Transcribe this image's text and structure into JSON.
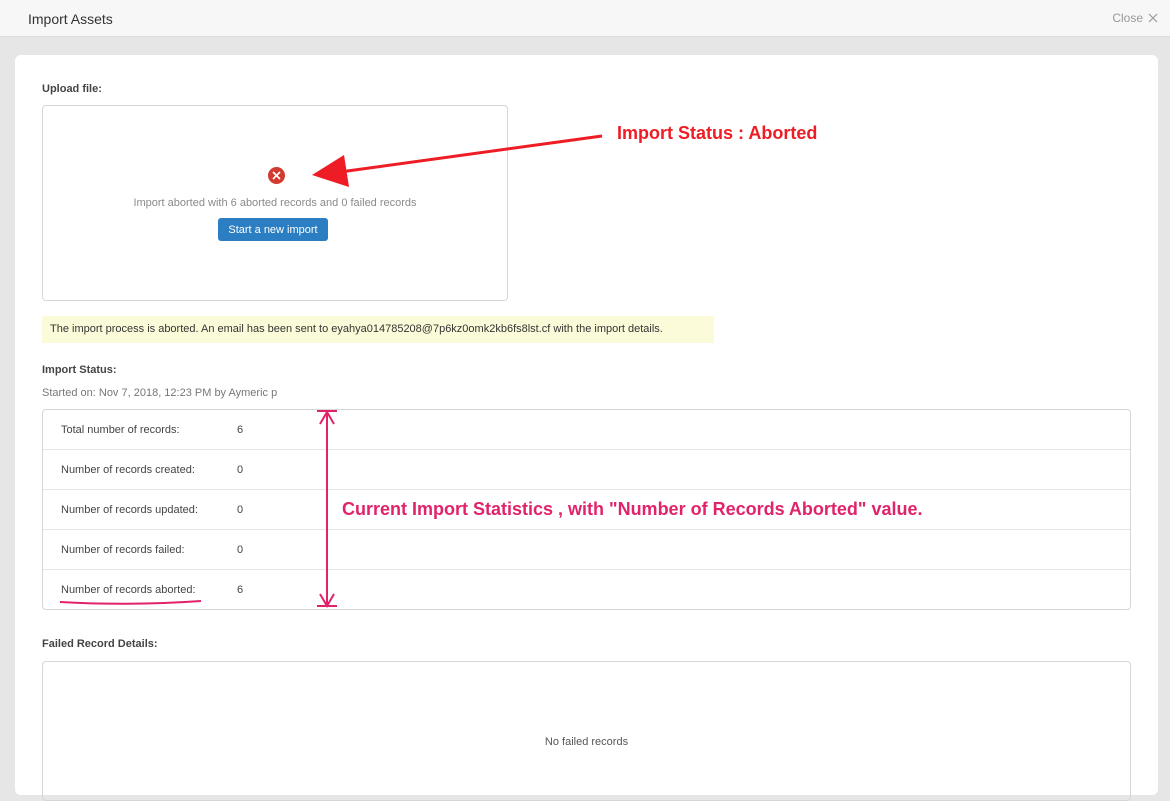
{
  "window": {
    "title": "Import Assets",
    "close_label": "Close"
  },
  "upload": {
    "section_label": "Upload file:",
    "status_icon": "error-x-icon",
    "message": "Import aborted with 6 aborted records and 0 failed records",
    "new_import_button": "Start a new import"
  },
  "notice": {
    "text": "The import process is aborted. An email has been sent to eyahya014785208@7p6kz0omk2kb6fs8lst.cf with the import details."
  },
  "import_status": {
    "section_label": "Import Status:",
    "started": "Started on: Nov 7, 2018, 12:23 PM by Aymeric p",
    "rows": [
      {
        "label": "Total number of records:",
        "value": "6"
      },
      {
        "label": "Number of records created:",
        "value": "0"
      },
      {
        "label": "Number of records updated:",
        "value": "0"
      },
      {
        "label": "Number of records failed:",
        "value": "0"
      },
      {
        "label": "Number of records aborted:",
        "value": "6"
      }
    ]
  },
  "failed_details": {
    "section_label": "Failed Record Details:",
    "empty_text": "No failed records"
  },
  "annotations": {
    "status_callout": "Import Status : Aborted",
    "stats_callout": "Current Import Statistics , with \"Number of Records Aborted\" value."
  },
  "colors": {
    "primary_button": "#2b7ec1",
    "error_icon": "#d23b2f",
    "notice_bg": "#fcfbd9",
    "annotation_red": "#ee1c24",
    "annotation_pink": "#e0236a"
  }
}
